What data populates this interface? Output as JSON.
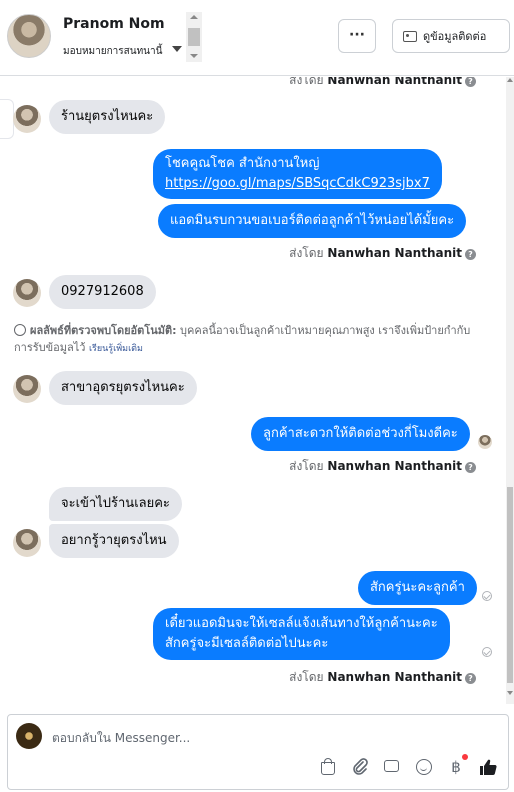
{
  "header": {
    "contact_name": "Pranom Nom",
    "assign_label": "มอบหมายการสนทนานี้",
    "more_label": "···",
    "view_contact_label": "ดูข้อมูลติดต่อ"
  },
  "conversation": {
    "sent_by_prefix": "ส่งโดย",
    "sender_name": "Nanwhan Nanthanit",
    "help_glyph": "?",
    "messages": {
      "in_1": "ร้านยุตรงไหนคะ",
      "out_1_line1": "โชคคูณโชค สำนักงานใหญ่",
      "out_1_link": "https://goo.gl/maps/SBSqcCdkC923sjbx7",
      "out_2": "แอดมินรบกวนขอเบอร์ติดต่อลูกค้าไว้หน่อยได้มั้ยคะ",
      "in_2": "0927912608",
      "in_3": "สาขาอุดรยุตรงไหนคะ",
      "out_3": "ลูกค้าสะดวกให้ติดต่อช่วงกี่โมงดีคะ",
      "in_4": "จะเข้าไปร้านเลยคะ",
      "in_5": "อยากรู้วายุตรงไหน",
      "out_4": "สักครู่นะคะลูกค้า",
      "out_5_line1": "เดี๋ยวแอดมินจะให้เซลล์แจ้งเส้นทางให้ลูกค้านะคะ",
      "out_5_line2": "สักครู่จะมีเซลล์ติดต่อไปนะคะ"
    },
    "auto_note": {
      "bold": "ผลลัพธ์ที่ตรวจพบโดยอัตโนมัติ:",
      "text": " บุคคลนี้อาจเป็นลูกค้าเป้าหมายคุณภาพสูง เราจึงเพิ่มป้ายกำกับการรับข้อมูลไว้ ",
      "link": "เรียนรู้เพิ่มเติม"
    }
  },
  "composer": {
    "placeholder": "ตอบกลับใน Messenger...",
    "baht_glyph": "฿"
  }
}
